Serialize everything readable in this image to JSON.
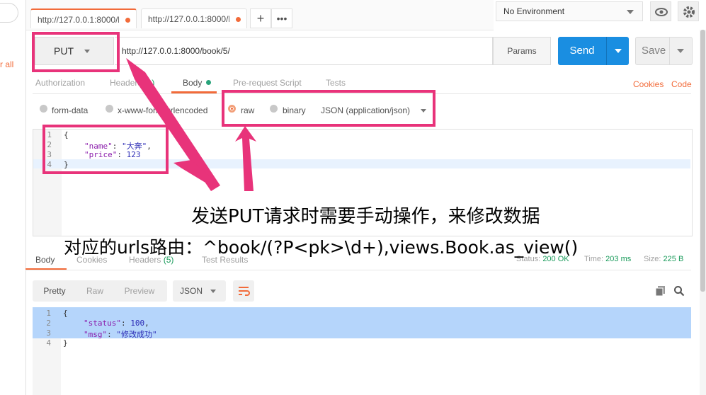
{
  "sidebar": {
    "clear_text": "r all"
  },
  "tabs": [
    {
      "label": "http://127.0.0.1:8000/b"
    },
    {
      "label": "http://127.0.0.1:8000/b"
    }
  ],
  "environment": {
    "label": "No Environment"
  },
  "request": {
    "method": "PUT",
    "url": "http://127.0.0.1:8000/book/5/",
    "params_label": "Params",
    "send_label": "Send",
    "save_label": "Save"
  },
  "request_tabs": {
    "authorization": "Authorization",
    "headers": "Headers",
    "headers_count": "(1)",
    "body": "Body",
    "prerequest": "Pre-request Script",
    "tests": "Tests",
    "cookies": "Cookies",
    "code": "Code"
  },
  "body_types": {
    "form_data": "form-data",
    "urlencoded": "x-www-form-urlencoded",
    "raw": "raw",
    "binary": "binary",
    "format": "JSON (application/json)"
  },
  "request_body": {
    "line_numbers": [
      "1",
      "2",
      "3",
      "4"
    ],
    "open": "{",
    "name_key": "\"name\"",
    "name_val": "\"大奔\"",
    "price_key": "\"price\"",
    "price_val": "123",
    "close": "}"
  },
  "annotation": {
    "line1": "发送PUT请求时需要手动操作，来修改数据",
    "line2": "对应的urls路由：^book/(?P<pk>\\d+),views.Book.as_view()"
  },
  "response_tabs": {
    "body": "Body",
    "cookies": "Cookies",
    "headers": "Headers",
    "headers_count": "(5)",
    "test_results": "Test Results"
  },
  "response_status": {
    "status_label": "Status:",
    "status_value": "200 OK",
    "time_label": "Time:",
    "time_value": "203 ms",
    "size_label": "Size:",
    "size_value": "225 B"
  },
  "response_view": {
    "pretty": "Pretty",
    "raw": "Raw",
    "preview": "Preview",
    "format": "JSON"
  },
  "response_body": {
    "line_numbers": [
      "1",
      "2",
      "3",
      "4"
    ],
    "open": "{",
    "status_key": "\"status\"",
    "status_val": "100",
    "msg_key": "\"msg\"",
    "msg_val": "\"修改成功\"",
    "close": "}"
  },
  "colors": {
    "accent": "#f26b3a",
    "send": "#1a8ee1",
    "annotation": "#e8337a"
  }
}
